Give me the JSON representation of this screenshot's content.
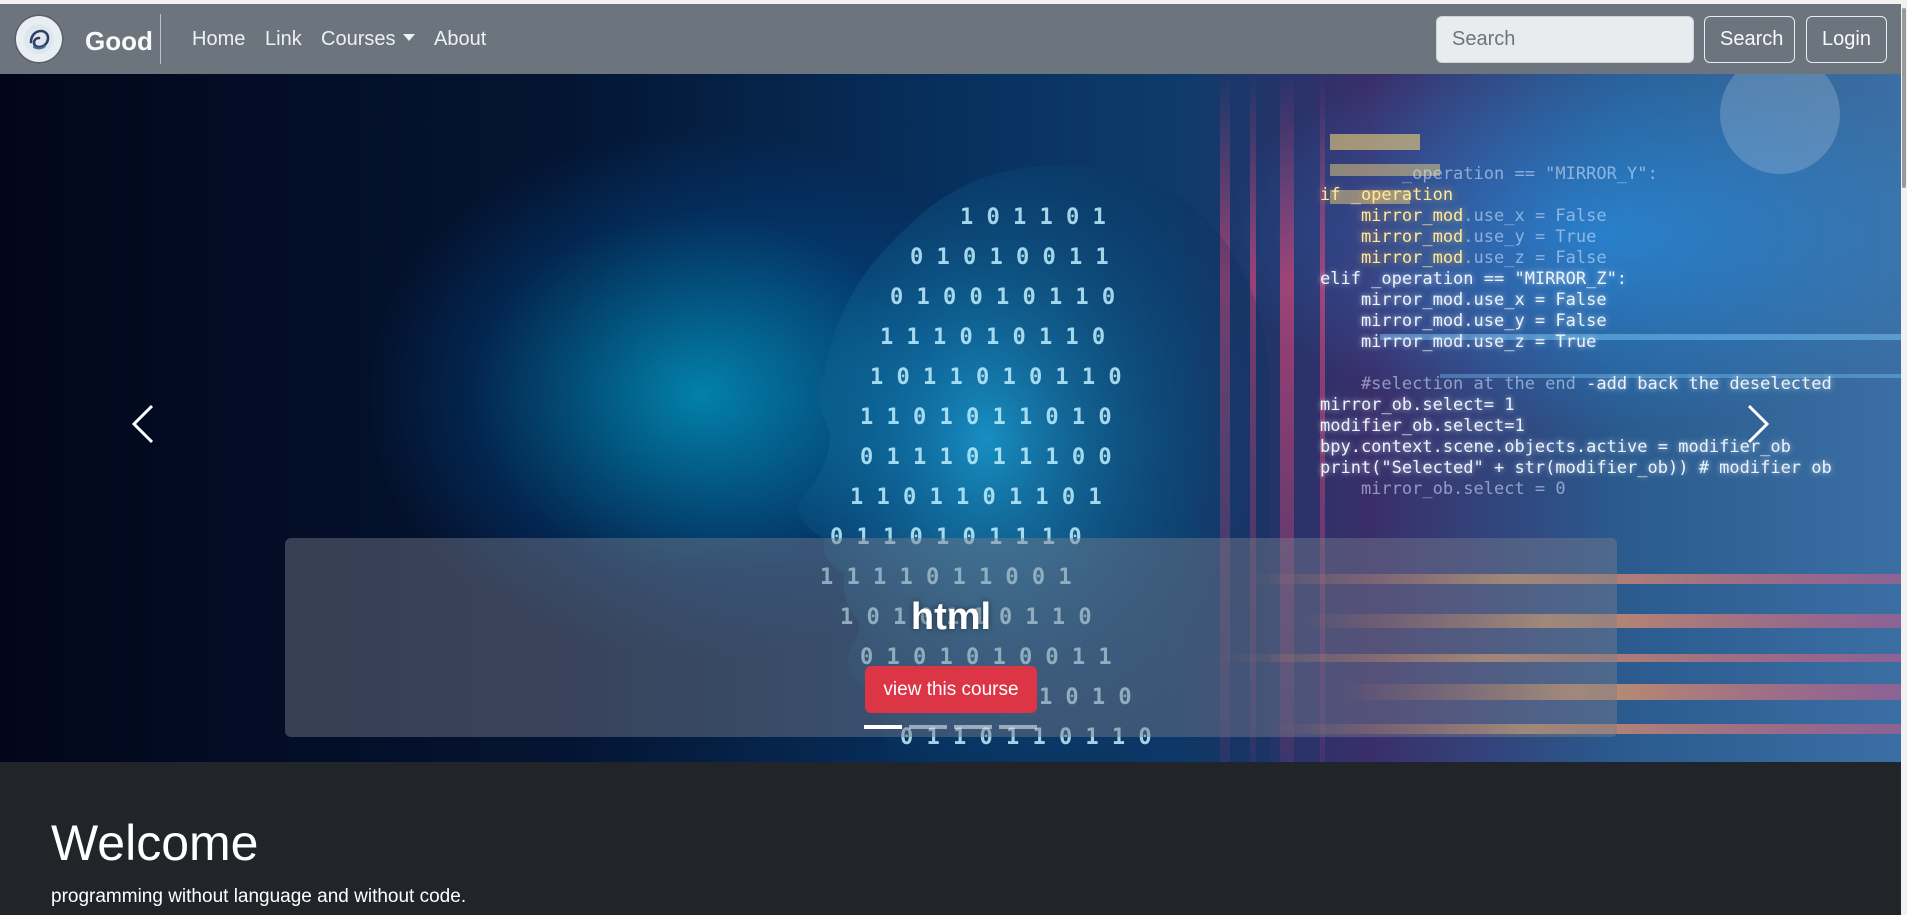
{
  "navbar": {
    "brand": "Good",
    "logo_icon": "brain-logo-icon",
    "links": {
      "home": "Home",
      "link": "Link",
      "courses": "Courses",
      "about": "About"
    },
    "search_placeholder": "Search",
    "search_button": "Search",
    "login_button": "Login"
  },
  "carousel": {
    "caption_title": "html",
    "caption_button": "view this course",
    "slide_count": 4,
    "active_slide": 1,
    "prev_icon": "chevron-left-icon",
    "next_icon": "chevron-right-icon"
  },
  "welcome": {
    "title": "Welcome",
    "text": "programming without language and without code."
  },
  "colors": {
    "navbar": "#6c757d",
    "page_bg": "#212529",
    "accent_button": "#dc3545"
  }
}
